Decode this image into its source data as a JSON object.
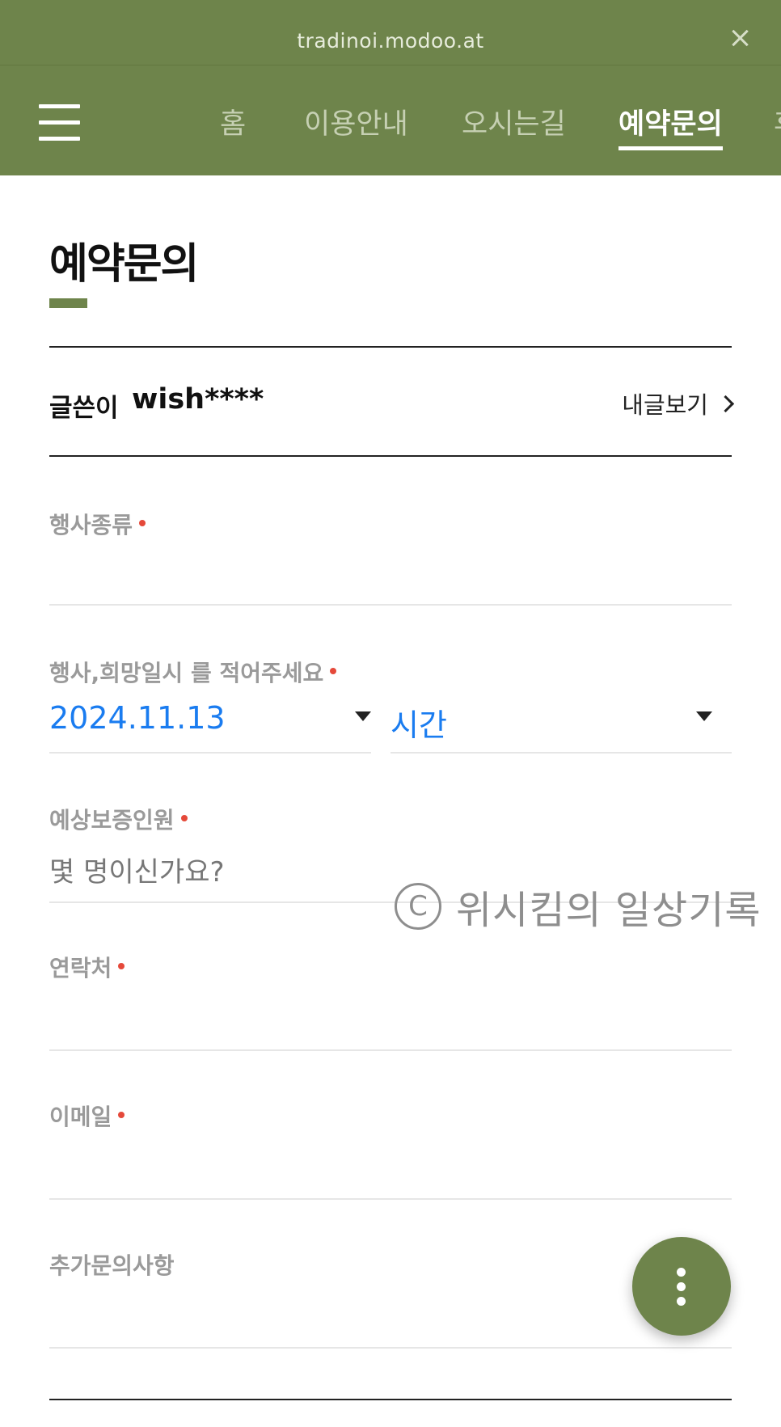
{
  "browser": {
    "url": "tradinoi.modoo.at"
  },
  "nav": {
    "tabs": [
      {
        "label": "홈",
        "active": false
      },
      {
        "label": "이용안내",
        "active": false
      },
      {
        "label": "오시는길",
        "active": false
      },
      {
        "label": "예약문의",
        "active": true
      },
      {
        "label": "후",
        "active": false
      }
    ]
  },
  "page": {
    "title": "예약문의"
  },
  "writer": {
    "label": "글쓴이",
    "value": "wish****",
    "my_posts": "내글보기"
  },
  "form": {
    "event_type": {
      "label": "행사종류",
      "value": ""
    },
    "date_time": {
      "label": "행사,희망일시 를 적어주세요",
      "date": "2024.11.13",
      "time": "시간"
    },
    "guests": {
      "label": "예상보증인원",
      "placeholder": "몇 명이신가요?"
    },
    "contact": {
      "label": "연락처",
      "value": ""
    },
    "email": {
      "label": "이메일",
      "value": ""
    },
    "extra": {
      "label": "추가문의사항",
      "value": ""
    }
  },
  "watermark": {
    "symbol": "C",
    "text": "위시킴의 일상기록"
  },
  "colors": {
    "brand": "#6e844b",
    "link": "#1a7cf0",
    "required": "#e5493a"
  }
}
